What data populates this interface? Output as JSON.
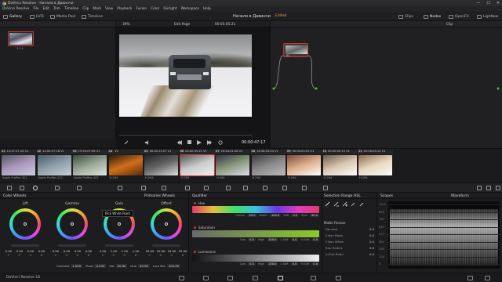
{
  "titlebar": {
    "title": "DaVinci Resolve - Начало в Давинчи",
    "minimize": "—",
    "maximize": "☐",
    "close": "✕"
  },
  "menubar": [
    "DaVinci Resolve",
    "File",
    "Edit",
    "Trim",
    "Timeline",
    "Clip",
    "Mark",
    "View",
    "Playback",
    "Fusion",
    "Color",
    "Fairlight",
    "Workspace",
    "Help"
  ],
  "toolbar": {
    "gallery": "Gallery",
    "luts": "LUTs",
    "media_pool": "Media Pool",
    "timeline": "Timeline",
    "project_title": "Начало в Давинчи",
    "project_status": "Edited",
    "clips": "Clips",
    "nodes": "Nodes",
    "openfx": "OpenFX",
    "lightbox": "Lightbox"
  },
  "viewer": {
    "zoom": "39%",
    "mode": "Edit Page",
    "source_tc": "00:05:05:21",
    "timecode": "00:00:47:17"
  },
  "gallery": {
    "still_label": "1.1.1"
  },
  "nodes": {
    "mode": "Clip",
    "node_number": "01"
  },
  "clips": [
    {
      "num": "01",
      "tc": "13:57:27:16",
      "track": "V1",
      "codec": "Apple ProRes 422",
      "colors": [
        "#556",
        "#a9b",
        "#ccd"
      ]
    },
    {
      "num": "02",
      "tc": "14:00:27:18",
      "track": "V1",
      "codec": "Apple ProRes 422",
      "colors": [
        "#4a5a66",
        "#8fa0aa",
        "#c8d0d4"
      ]
    },
    {
      "num": "03",
      "tc": "13:50:07:06",
      "track": "V1",
      "codec": "Apple ProRes 422",
      "colors": [
        "#3a4a3a",
        "#9aa89a",
        "#e0e6e0"
      ]
    },
    {
      "num": "04",
      "tc": "",
      "track": "V1",
      "codec": "H.264",
      "colors": [
        "#2a1a0a",
        "#d0701a",
        "#5a2a0a"
      ]
    },
    {
      "num": "05",
      "tc": "00:00:11:07",
      "track": "V1",
      "codec": "H.264",
      "colors": [
        "#222",
        "#666",
        "#ddd"
      ]
    },
    {
      "num": "06",
      "tc": "00:00:05:21",
      "track": "V1",
      "codec": "H.264",
      "colors": [
        "#555",
        "#ccc",
        "#eee"
      ]
    },
    {
      "num": "07",
      "tc": "16:44:31:08",
      "track": "V1",
      "codec": "H.264",
      "colors": [
        "#334",
        "#8a9a7a",
        "#dde"
      ]
    },
    {
      "num": "08",
      "tc": "16:58:03:04",
      "track": "V1",
      "codec": "H.264",
      "colors": [
        "#3a3a3a",
        "#8a8a8a",
        "#bbb"
      ]
    },
    {
      "num": "09",
      "tc": "00:00:03:03",
      "track": "V1",
      "codec": "H.264",
      "colors": [
        "#7a4a3a",
        "#e0b090",
        "#fff"
      ]
    },
    {
      "num": "10",
      "tc": "00:00:02:15",
      "track": "V1",
      "codec": "H.264",
      "colors": [
        "#6a5a4a",
        "#d8c8b0",
        "#fff"
      ]
    },
    {
      "num": "11",
      "tc": "00:00:03:12",
      "track": "V1",
      "codec": "H.264",
      "colors": [
        "#8a6a4a",
        "#e8d8c0",
        "#fafafa"
      ]
    }
  ],
  "wheels": {
    "title": "Color Wheels",
    "mode": "Primaries Wheels",
    "items": [
      {
        "name": "Lift",
        "y": "0.00",
        "r": "0.00",
        "g": "0.00",
        "b": "0.00"
      },
      {
        "name": "Gamma",
        "y": "0.00",
        "r": "0.00",
        "g": "0.00",
        "b": "0.00"
      },
      {
        "name": "Gain",
        "y": "1.00",
        "r": "1.00",
        "g": "1.00",
        "b": "1.00"
      },
      {
        "name": "Offset",
        "y": "25.00",
        "r": "25.00",
        "g": "25.00",
        "b": "25.00"
      }
    ],
    "chan_labels": [
      "Y",
      "R",
      "G",
      "B"
    ],
    "tooltip": "Pick White Point",
    "adjust": [
      {
        "label": "Contrast",
        "value": "1.000"
      },
      {
        "label": "Pivot",
        "value": "0.435"
      },
      {
        "label": "Sat",
        "value": "50.00"
      },
      {
        "label": "Hue",
        "value": "50.00"
      },
      {
        "label": "Lum Mix",
        "value": "100.00"
      }
    ]
  },
  "qualifier": {
    "title": "Qualifier",
    "mode": "HSL",
    "hue": {
      "name": "Hue",
      "center_label": "Center",
      "center": "50.0",
      "width_label": "Width",
      "width": "100.0",
      "soft_label": "Soft",
      "soft": "0.0",
      "sym_label": "Sym",
      "sym": "50.0"
    },
    "sat": {
      "name": "Saturation",
      "low_label": "Low",
      "low": "0.0",
      "high_label": "High",
      "high": "100.0",
      "lsoft_label": "L.Soft",
      "lsoft": "0.0",
      "hsoft_label": "H.Soft",
      "hsoft": "0.0"
    },
    "lum": {
      "name": "Luminance",
      "low_label": "Low",
      "low": "0.0",
      "high_label": "High",
      "high": "100.0",
      "lsoft_label": "L.Soft",
      "lsoft": "0.0",
      "hsoft_label": "H.Soft",
      "hsoft": "0.0"
    }
  },
  "selection": {
    "title": "Selection Range",
    "finesse": "Matte Finesse",
    "rows": [
      {
        "label": "Denoise",
        "value": "0.0"
      },
      {
        "label": "Clean Black",
        "value": "0.0"
      },
      {
        "label": "Clean White",
        "value": "0.0"
      },
      {
        "label": "Blur Radius",
        "value": "0.0"
      },
      {
        "label": "In/Out Ratio",
        "value": "0.0"
      }
    ]
  },
  "scopes": {
    "title": "Scopes",
    "mode": "Waveform",
    "ticks": [
      "1023",
      "896",
      "768",
      "640",
      "512",
      "384",
      "256",
      "128",
      "0"
    ]
  },
  "statusbar": {
    "app": "DaVinci Resolve 16"
  }
}
